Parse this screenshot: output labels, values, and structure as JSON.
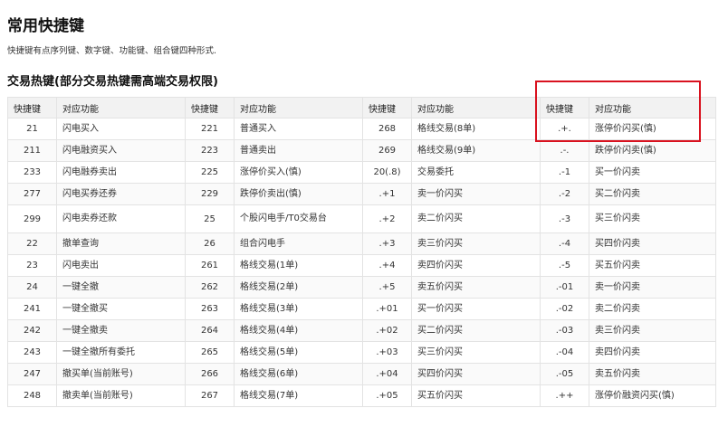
{
  "page_title": "常用快捷键",
  "intro": "快捷键有点序列键、数字键、功能键、组合键四种形式.",
  "section_title": "交易热键(部分交易热键需高端交易权限)",
  "header": [
    "快捷键",
    "对应功能",
    "快捷键",
    "对应功能",
    "快捷键",
    "对应功能",
    "快捷键",
    "对应功能"
  ],
  "rows": [
    {
      "cells": [
        "21",
        "闪电买入",
        "221",
        "普通买入",
        "268",
        "格线交易(8单)",
        ".+.",
        "涨停价闪买(慎)"
      ]
    },
    {
      "cells": [
        "211",
        "闪电融资买入",
        "223",
        "普通卖出",
        "269",
        "格线交易(9单)",
        ".-.",
        "跌停价闪卖(慎)"
      ]
    },
    {
      "cells": [
        "233",
        "闪电融券卖出",
        "225",
        "涨停价买入(慎)",
        "20(.8)",
        "交易委托",
        ".-1",
        "买一价闪卖"
      ]
    },
    {
      "cells": [
        "277",
        "闪电买券还券",
        "229",
        "跌停价卖出(慎)",
        ".+1",
        "卖一价闪买",
        ".-2",
        "买二价闪卖"
      ]
    },
    {
      "cells": [
        "299",
        "闪电卖券还款",
        "25",
        "个股闪电手/T0交易台",
        ".+2",
        "卖二价闪买",
        ".-3",
        "买三价闪卖"
      ]
    },
    {
      "cells": [
        "22",
        "撤单查询",
        "26",
        "组合闪电手",
        ".+3",
        "卖三价闪买",
        ".-4",
        "买四价闪卖"
      ]
    },
    {
      "cells": [
        "23",
        "闪电卖出",
        "261",
        "格线交易(1单)",
        ".+4",
        "卖四价闪买",
        ".-5",
        "买五价闪卖"
      ]
    },
    {
      "cells": [
        "24",
        "一键全撤",
        "262",
        "格线交易(2单)",
        ".+5",
        "卖五价闪买",
        ".-01",
        "卖一价闪卖"
      ]
    },
    {
      "cells": [
        "241",
        "一键全撤买",
        "263",
        "格线交易(3单)",
        ".+01",
        "买一价闪买",
        ".-02",
        "卖二价闪卖"
      ]
    },
    {
      "cells": [
        "242",
        "一键全撤卖",
        "264",
        "格线交易(4单)",
        ".+02",
        "买二价闪买",
        ".-03",
        "卖三价闪卖"
      ]
    },
    {
      "cells": [
        "243",
        "一键全撤所有委托",
        "265",
        "格线交易(5单)",
        ".+03",
        "买三价闪买",
        ".-04",
        "卖四价闪卖"
      ]
    },
    {
      "cells": [
        "247",
        "撤买单(当前账号)",
        "266",
        "格线交易(6单)",
        ".+04",
        "买四价闪买",
        ".-05",
        "卖五价闪卖"
      ]
    },
    {
      "cells": [
        "248",
        "撤卖单(当前账号)",
        "267",
        "格线交易(7单)",
        ".+05",
        "买五价闪买",
        ".++",
        "涨停价融资闪买(慎)"
      ]
    }
  ],
  "highlight_color": "#d9121f"
}
